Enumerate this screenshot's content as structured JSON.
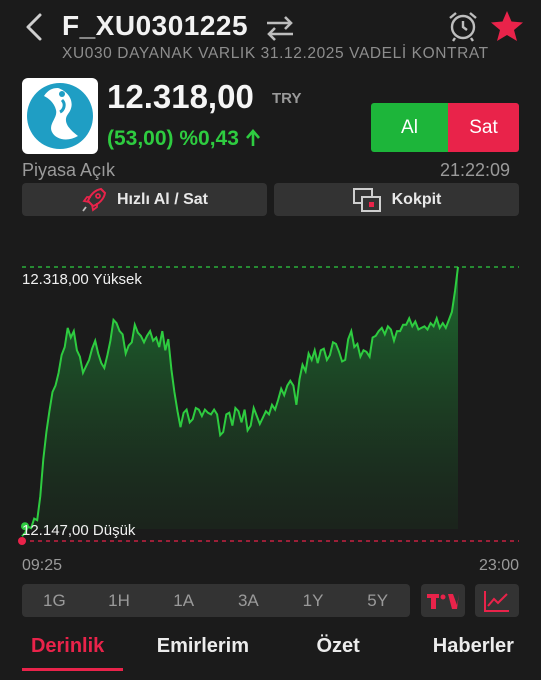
{
  "header": {
    "title": "F_XU0301225",
    "subtitle": "XU030 DAYANAK VARLIK 31.12.2025 VADELİ KONTRAT"
  },
  "quote": {
    "price": "12.318,00",
    "currency": "TRY",
    "change": "(53,00) %0,43",
    "market_status": "Piyasa Açık",
    "time": "21:22:09"
  },
  "trade": {
    "buy_label": "Al",
    "sell_label": "Sat"
  },
  "actions": {
    "quick_trade_label": "Hızlı Al / Sat",
    "cockpit_label": "Kokpit"
  },
  "colors": {
    "up": "#2ecc40",
    "down": "#e9234a",
    "buy": "#1db53a",
    "sell": "#e9234a"
  },
  "chart_data": {
    "type": "area",
    "high_label": "12.318,00 Yüksek",
    "low_label": "12.147,00 Düşük",
    "high": 12318,
    "low": 12147,
    "x_start_label": "09:25",
    "x_end_label": "23:00",
    "values": [
      12150,
      12152,
      12156,
      12155,
      12161,
      12160,
      12175,
      12198,
      12215,
      12228,
      12240,
      12244,
      12252,
      12263,
      12268,
      12280,
      12274,
      12278,
      12266,
      12262,
      12252,
      12256,
      12260,
      12267,
      12272,
      12264,
      12258,
      12255,
      12263,
      12272,
      12285,
      12283,
      12278,
      12276,
      12264,
      12269,
      12271,
      12282,
      12277,
      12275,
      12271,
      12275,
      12278,
      12272,
      12274,
      12268,
      12278,
      12266,
      12273,
      12254,
      12240,
      12228,
      12218,
      12227,
      12229,
      12221,
      12223,
      12230,
      12229,
      12225,
      12229,
      12227,
      12226,
      12229,
      12226,
      12213,
      12215,
      12226,
      12227,
      12219,
      12230,
      12228,
      12221,
      12229,
      12216,
      12219,
      12230,
      12225,
      12220,
      12224,
      12228,
      12226,
      12232,
      12229,
      12235,
      12242,
      12238,
      12244,
      12247,
      12244,
      12232,
      12248,
      12257,
      12253,
      12264,
      12260,
      12266,
      12258,
      12266,
      12267,
      12260,
      12263,
      12271,
      12270,
      12265,
      12259,
      12260,
      12273,
      12278,
      12268,
      12270,
      12262,
      12266,
      12265,
      12262,
      12274,
      12275,
      12278,
      12280,
      12276,
      12281,
      12279,
      12272,
      12278,
      12278,
      12282,
      12282,
      12286,
      12281,
      12284,
      12279,
      12280,
      12281,
      12279,
      12283,
      12281,
      12286,
      12280,
      12283,
      12280,
      12285,
      12290,
      12303,
      12318
    ]
  },
  "ranges": [
    "1G",
    "1H",
    "1A",
    "3A",
    "1Y",
    "5Y"
  ],
  "active_range": "1G",
  "tabs": [
    "Derinlik",
    "Emirlerim",
    "Özet",
    "Haberler"
  ],
  "active_tab": "Derinlik"
}
